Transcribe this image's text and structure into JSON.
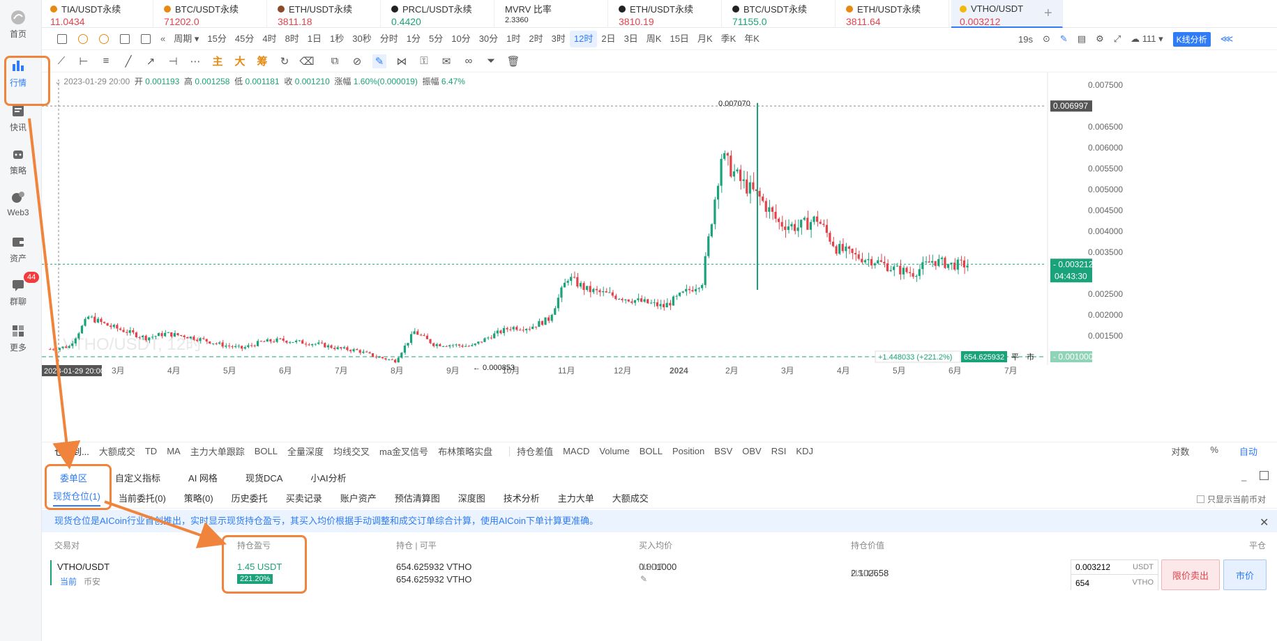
{
  "sidebar": {
    "items": [
      {
        "label": "首页",
        "icon": "home-icon"
      },
      {
        "label": "行情",
        "icon": "bar-chart-icon"
      },
      {
        "label": "快讯",
        "icon": "news-icon"
      },
      {
        "label": "策略",
        "icon": "robot-icon"
      },
      {
        "label": "Web3",
        "icon": "web3-icon"
      },
      {
        "label": "资产",
        "icon": "wallet-icon"
      },
      {
        "label": "群聊",
        "icon": "chat-icon",
        "badge": "44"
      },
      {
        "label": "更多",
        "icon": "grid-icon"
      }
    ]
  },
  "tabs": [
    {
      "name": "TIA/USDT永续",
      "price": "11.0434",
      "dir": "up",
      "coin": "#e88a12"
    },
    {
      "name": "BTC/USDT永续",
      "price": "71202.0",
      "dir": "up",
      "coin": "#e88a12"
    },
    {
      "name": "ETH/USDT永续",
      "price": "3811.18",
      "dir": "up",
      "coin": "#8a4b2a"
    },
    {
      "name": "PRCL/USDT永续",
      "price": "0.4420",
      "dir": "dn",
      "coin": "#222"
    },
    {
      "name": "MVRV 比率",
      "price": "2.3360",
      "dir": "none",
      "coin": ""
    },
    {
      "name": "ETH/USDT永续",
      "price": "3810.19",
      "dir": "up",
      "coin": "#222"
    },
    {
      "name": "BTC/USDT永续",
      "price": "71155.0",
      "dir": "dn",
      "coin": "#222"
    },
    {
      "name": "ETH/USDT永续",
      "price": "3811.64",
      "dir": "up",
      "coin": "#e88a12"
    },
    {
      "name": "VTHO/USDT",
      "price": "0.003212",
      "dir": "up",
      "coin": "#f0b90b"
    }
  ],
  "toolbar1": {
    "period_label": "周期",
    "intervals": [
      "15分",
      "45分",
      "4时",
      "8时",
      "1日",
      "1秒",
      "30秒",
      "分时",
      "1分",
      "5分",
      "10分",
      "30分",
      "1时",
      "2时",
      "3时",
      "12时",
      "2日",
      "3日",
      "周K",
      "15日",
      "月K",
      "季K",
      "年K"
    ],
    "selected": "12时",
    "right": {
      "refresh": "19s",
      "count": "111",
      "kline_btn": "K线分析"
    }
  },
  "toolbar2": {
    "text_tools": [
      "主",
      "大",
      "筹"
    ]
  },
  "ohlc": {
    "date": "2023-01-29 20:00",
    "open_label": "开",
    "open": "0.001193",
    "high_label": "高",
    "high": "0.001258",
    "low_label": "低",
    "low": "0.001181",
    "close_label": "收",
    "close": "0.001210",
    "chg_label": "涨幅",
    "chg": "1.60%(0.000019)",
    "amp_label": "振幅",
    "amp": "6.47%"
  },
  "chart_data": {
    "type": "candlestick",
    "y_axis": [
      "0.007500",
      "0.006500",
      "0.006000",
      "0.005500",
      "0.005000",
      "0.004500",
      "0.004000",
      "0.003500",
      "0.002500",
      "0.002000",
      "0.001500"
    ],
    "x_axis": [
      "3月",
      "4月",
      "5月",
      "6月",
      "7月",
      "8月",
      "9月",
      "10月",
      "11月",
      "12月",
      "2024",
      "2月",
      "3月",
      "4月",
      "5月",
      "6月",
      "7月"
    ],
    "high_marker": "0.007070",
    "low_marker": "0.000853",
    "last_price": "0.003212",
    "countdown": "04:43:30",
    "crosshair_price": "0.006997",
    "crosshair_time": "2023-01-29 20:00",
    "position_line": {
      "pnl": "+1.448033 (+221.2%)",
      "amount": "654.625932",
      "close_label": "平",
      "market_label": "市",
      "price": "0.001000"
    },
    "watermark": "VTHO/USDT, 12时",
    "ylim": [
      0.0008,
      0.0078
    ],
    "candles_approx": [
      0.00118,
      0.00125,
      0.00195,
      0.00175,
      0.0016,
      0.00145,
      0.00155,
      0.0015,
      0.0014,
      0.00128,
      0.0012,
      0.00135,
      0.0014,
      0.00135,
      0.0013,
      0.0012,
      0.00115,
      0.001,
      0.0009,
      0.0016,
      0.0013,
      0.00128,
      0.00125,
      0.0015,
      0.0017,
      0.0017,
      0.0019,
      0.0029,
      0.0026,
      0.0025,
      0.0024,
      0.0023,
      0.0022,
      0.0025,
      0.0028,
      0.0058,
      0.0052,
      0.0048,
      0.0042,
      0.0041,
      0.0043,
      0.0036,
      0.0034,
      0.0033,
      0.0031,
      0.003,
      0.0033,
      0.0032
    ]
  },
  "indicators": {
    "first": "仓位到...",
    "main": [
      "大额成交",
      "TD",
      "MA",
      "主力大单跟踪",
      "BOLL",
      "全量深度",
      "均线交叉",
      "ma金叉信号",
      "布林策略实盘"
    ],
    "sub": [
      "持仓差值",
      "MACD",
      "Volume",
      "BOLL",
      "Position",
      "BSV",
      "OBV",
      "RSI",
      "KDJ"
    ],
    "right": [
      "对数",
      "%",
      "自动"
    ]
  },
  "panel_tabs": [
    "委单区",
    "自定义指标",
    "AI 网格",
    "现货DCA",
    "小AI分析"
  ],
  "sub_tabs": [
    {
      "label": "现货仓位(1)"
    },
    {
      "label": "当前委托(0)"
    },
    {
      "label": "策略(0)"
    },
    {
      "label": "历史委托"
    },
    {
      "label": "买卖记录"
    },
    {
      "label": "账户资产"
    },
    {
      "label": "预估清算图"
    },
    {
      "label": "深度图"
    },
    {
      "label": "技术分析"
    },
    {
      "label": "主力大单"
    },
    {
      "label": "大额成交"
    }
  ],
  "only_current": "只显示当前币对",
  "notice": "现货仓位是AICoin行业首创推出，实时显示现货持仓盈亏，其买入均价根据手动调整和成交订单综合计算，使用AICoin下单计算更准确。",
  "table": {
    "headers": [
      "交易对",
      "持仓盈亏",
      "持仓 | 可平",
      "买入均价",
      "持仓价值",
      "平仓"
    ],
    "row": {
      "pair": "VTHO/USDT",
      "tag": "当前",
      "exchange": "币安",
      "pnl": "1.45 USDT",
      "pnl_pct": "221.20%",
      "hold": "654.625932 VTHO",
      "avail": "654.625932 VTHO",
      "avg_price": "0.001000",
      "avg_unit": "USDT",
      "value": "2.102658",
      "value_unit": "USDT",
      "price_input": "0.003212",
      "price_unit": "USDT",
      "qty_input": "654",
      "qty_unit": "VTHO",
      "limit_sell": "限价卖出",
      "market": "市价"
    }
  }
}
